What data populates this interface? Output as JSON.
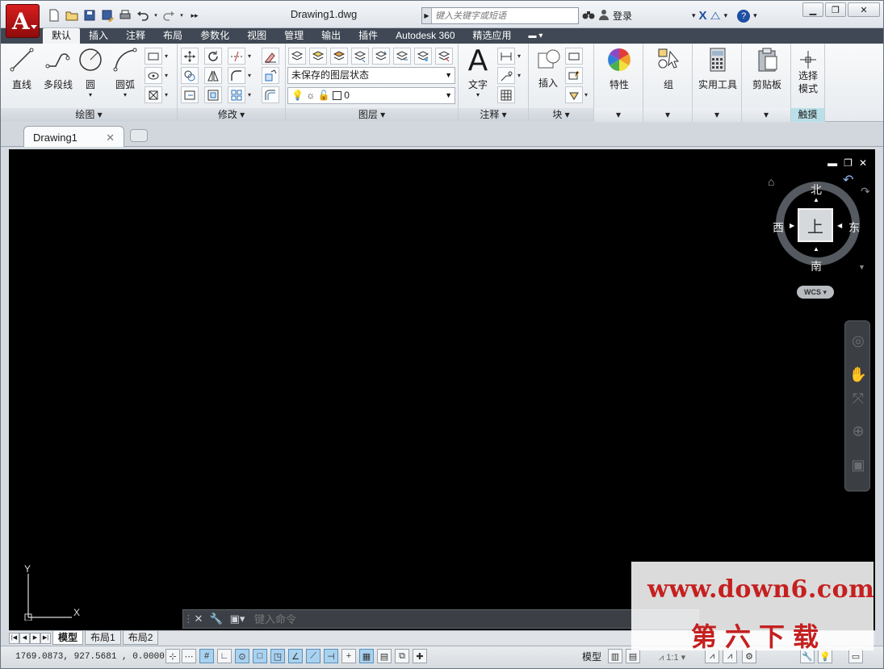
{
  "app": {
    "logo_letter": "A",
    "title": "Drawing1.dwg"
  },
  "search": {
    "placeholder": "键入关键字或短语"
  },
  "user": {
    "signin_label": "登录"
  },
  "ribbon_tabs": [
    "默认",
    "插入",
    "注释",
    "布局",
    "参数化",
    "视图",
    "管理",
    "输出",
    "插件",
    "Autodesk 360",
    "精选应用"
  ],
  "active_tab_index": 0,
  "panels": {
    "draw": {
      "title": "绘图",
      "buttons": {
        "line": "直线",
        "polyline": "多段线",
        "circle": "圆",
        "arc": "圆弧"
      }
    },
    "modify": {
      "title": "修改"
    },
    "layers": {
      "title": "图层",
      "layer_state": "未保存的图层状态",
      "current_layer": "0"
    },
    "annotation": {
      "title": "注释",
      "text_label": "文字"
    },
    "block": {
      "title": "块",
      "insert_label": "插入"
    },
    "properties": {
      "label": "特性"
    },
    "groups": {
      "label": "组"
    },
    "utilities": {
      "label": "实用工具"
    },
    "clipboard": {
      "label": "剪贴板"
    },
    "touch": {
      "label": "选择\n模式",
      "title": "触摸"
    }
  },
  "file_tab": {
    "name": "Drawing1"
  },
  "viewcube": {
    "north": "北",
    "south": "南",
    "east": "东",
    "west": "西",
    "face": "上",
    "ucs": "WCS"
  },
  "ucs_icon": {
    "x_label": "X",
    "y_label": "Y"
  },
  "command_line": {
    "placeholder": "键入命令"
  },
  "layout_tabs": [
    "模型",
    "布局1",
    "布局2"
  ],
  "active_layout_index": 0,
  "status": {
    "coordinates": "1769.0873, 927.5681 , 0.0000",
    "model_label": "模型",
    "scale": "1:1"
  },
  "watermark": {
    "url": "www.down6.com",
    "cn": "第六下载"
  },
  "colors": {
    "accent_red": "#c52020",
    "ribbon_tab_bg": "#3f4854",
    "canvas_bg": "#000000",
    "status_on": "#a9d2f0"
  }
}
